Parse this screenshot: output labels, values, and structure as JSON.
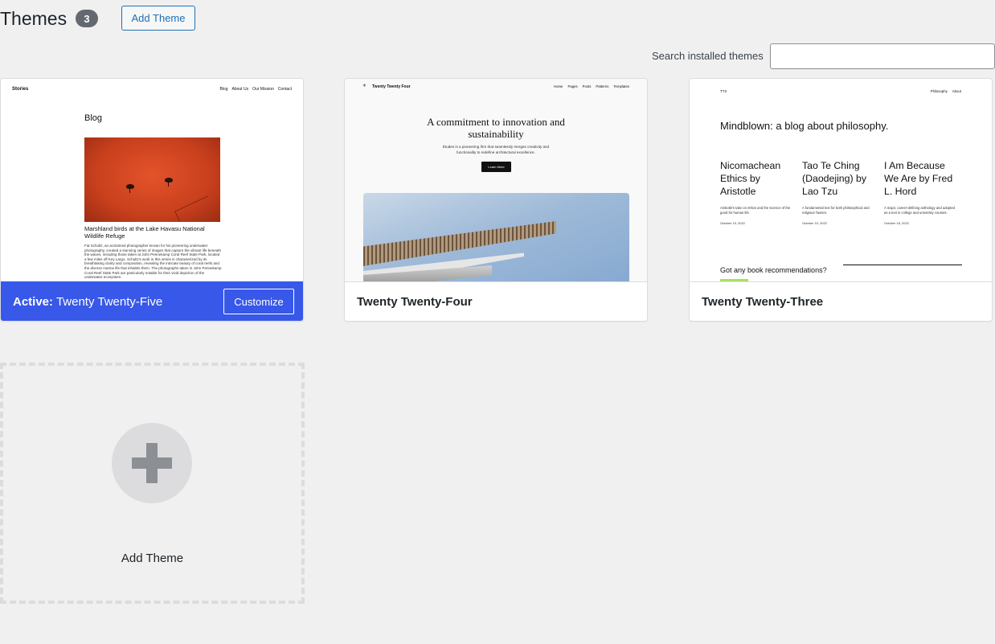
{
  "header": {
    "title": "Themes",
    "count": "3",
    "add_theme_label": "Add Theme"
  },
  "search": {
    "label": "Search installed themes",
    "value": "",
    "placeholder": ""
  },
  "themes": [
    {
      "name": "Twenty Twenty-Five",
      "active": true,
      "active_prefix": "Active:",
      "customize_label": "Customize",
      "preview": {
        "site_title": "Stories",
        "nav": [
          "Blog",
          "About Us",
          "Our Mission",
          "Contact"
        ],
        "heading": "Blog",
        "post_title": "Marshland birds at the Lake Havasu National Wildlife Refuge",
        "excerpt": "Fiø Schultz, an acclaimed photographer known for his pioneering underwater photography, created a stunning series of images that capture the vibrant life beneath the waves, including those taken at John Pennekamp Coral Reef State Park, located a few miles off Key Largo. Schultz's work in this series is characterized by its breathtaking clarity and composition, revealing the intricate beauty of coral reefs and the diverse marine life that inhabits them. The photographs taken in John Pennekamp Coral Reef State Park are particularly notable for their vivid depiction of the underwater ecosystem."
      }
    },
    {
      "name": "Twenty Twenty-Four",
      "active": false,
      "preview": {
        "logo": "✳",
        "site_title": "Twenty Twenty Four",
        "nav": [
          "Home",
          "Pages",
          "Posts",
          "Patterns",
          "Templates"
        ],
        "headline": "A commitment to innovation and sustainability",
        "subtext": "Études is a pioneering firm that seamlessly merges creativity and functionality to redefine architectural excellence.",
        "button": "Learn More"
      }
    },
    {
      "name": "Twenty Twenty-Three",
      "active": false,
      "preview": {
        "site_title": "TT3",
        "nav": [
          "Philosophy",
          "About"
        ],
        "headline": "Mindblown: a blog about philosophy.",
        "posts": [
          {
            "title": "Nicomachean Ethics by Aristotle",
            "excerpt": "Aristotle's take on ethics and the science of the good for human life.",
            "date": "October 19, 2022"
          },
          {
            "title": "Tao Te Ching (Daodejing) by Lao Tzu",
            "excerpt": "A fundamental text for both philosophical and religious Taoism.",
            "date": "October 19, 2022"
          },
          {
            "title": "I Am Because We Are by Fred L. Hord",
            "excerpt": "A major, career-defining anthology and adopted as a text in college and university courses.",
            "date": "October 18, 2022"
          }
        ],
        "footer_prompt": "Got any book recommendations?"
      }
    }
  ],
  "add_new": {
    "label": "Add Theme"
  },
  "colors": {
    "active_blue": "#3858e9",
    "link_blue": "#2271b1",
    "badge_gray": "#646970"
  }
}
